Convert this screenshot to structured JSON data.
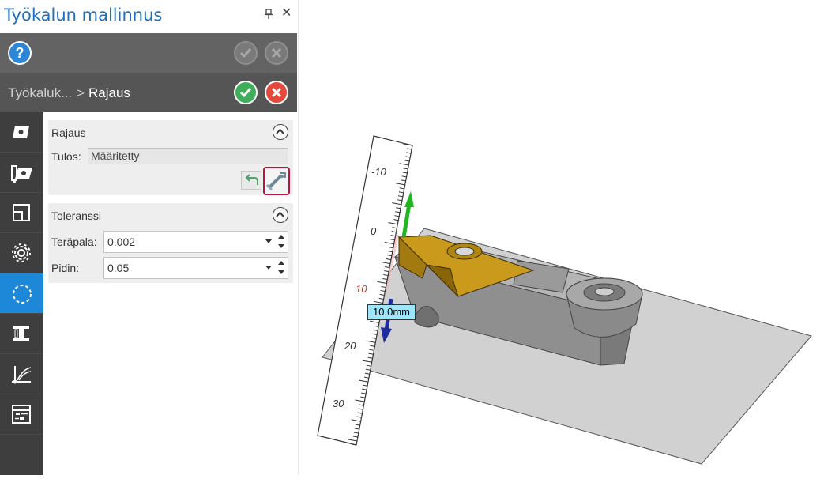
{
  "panel": {
    "title": "Työkalun mallinnus",
    "pin_icon": "pin-icon",
    "close_icon": "close-icon"
  },
  "topbar": {
    "help_label": "?",
    "ok_state": "disabled",
    "cancel_state": "disabled"
  },
  "breadcrumb": {
    "parent": "Työkaluk...",
    "separator": ">",
    "current": "Rajaus"
  },
  "sidebar": {
    "items": [
      {
        "icon": "insert-icon",
        "active": false
      },
      {
        "icon": "holder-insert-icon",
        "active": false
      },
      {
        "icon": "layout-icon",
        "active": false
      },
      {
        "icon": "gear-icon",
        "active": false
      },
      {
        "icon": "boundary-icon",
        "active": true
      },
      {
        "icon": "clamp-icon",
        "active": false
      },
      {
        "icon": "axis-icon",
        "active": false
      },
      {
        "icon": "settings-list-icon",
        "active": false
      }
    ]
  },
  "rajaus": {
    "title": "Rajaus",
    "result_label": "Tulos:",
    "result_value": "Määritetty",
    "undo_icon": "undo-icon",
    "define_icon": "define-boundary-icon"
  },
  "toleranssi": {
    "title": "Toleranssi",
    "terapala_label": "Teräpala:",
    "terapala_value": "0.002",
    "pidin_label": "Pidin:",
    "pidin_value": "0.05"
  },
  "viewport": {
    "ruler_ticks": [
      "-10",
      "0",
      "10",
      "20",
      "30"
    ],
    "dimension_label": "10.0mm",
    "colors": {
      "insert": "#c99a1c",
      "holder": "#8a8a8a",
      "plane": "#c9c9c9",
      "y_axis": "#22b522",
      "z_axis": "#1f2d9c",
      "dim_bg": "#9ee6fb"
    }
  }
}
